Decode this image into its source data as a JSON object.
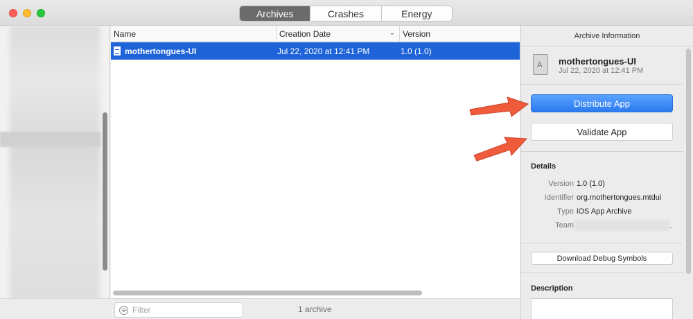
{
  "window": {
    "tabs": [
      {
        "label": "Archives",
        "active": true
      },
      {
        "label": "Crashes",
        "active": false
      },
      {
        "label": "Energy",
        "active": false
      }
    ]
  },
  "list": {
    "columns": {
      "name": "Name",
      "creation_date": "Creation Date",
      "version": "Version"
    },
    "rows": [
      {
        "name": "mothertongues-UI",
        "date": "Jul 22, 2020 at 12:41 PM",
        "version": "1.0 (1.0)",
        "selected": true
      }
    ],
    "filter_placeholder": "Filter",
    "count_label": "1 archive"
  },
  "inspector": {
    "title": "Archive Information",
    "app_name": "mothertongues-UI",
    "app_date": "Jul 22, 2020 at 12:41 PM",
    "distribute_label": "Distribute App",
    "validate_label": "Validate App",
    "details": {
      "heading": "Details",
      "version_key": "Version",
      "version_val": "1.0 (1.0)",
      "identifier_key": "Identifier",
      "identifier_val": "org.mothertongues.mtdui",
      "type_key": "Type",
      "type_val": "iOS App Archive",
      "team_key": "Team",
      "team_suffix": "."
    },
    "debug_symbols_label": "Download Debug Symbols",
    "description_heading": "Description"
  },
  "colors": {
    "selection": "#1f63d9",
    "primary_button": "#2a7bf0",
    "arrow": "#f05b3c"
  }
}
